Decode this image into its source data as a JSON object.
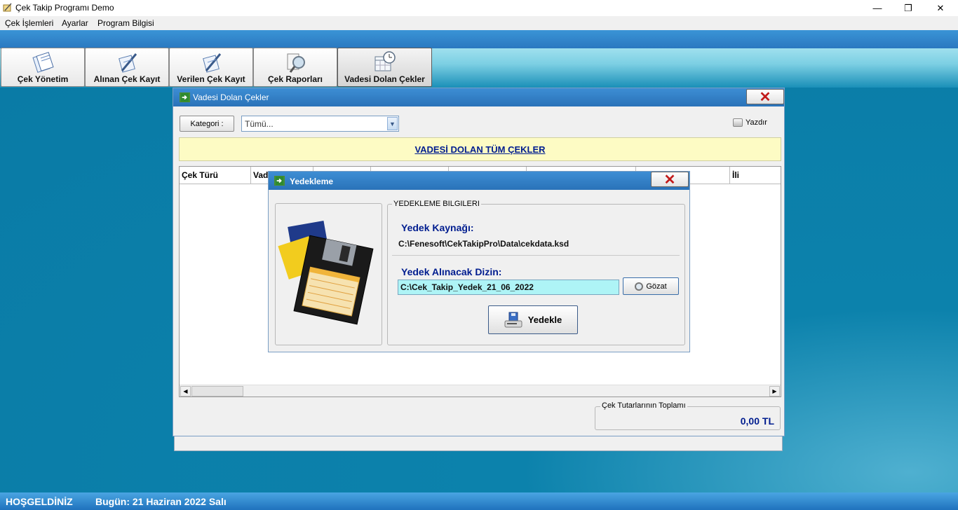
{
  "app": {
    "title": "Çek Takip Programı Demo",
    "window_controls": {
      "minimize": "—",
      "maximize": "❐",
      "close": "✕"
    }
  },
  "menu": {
    "items": [
      "Çek İşlemleri",
      "Ayarlar",
      "Program Bilgisi"
    ]
  },
  "toolbar": {
    "buttons": [
      {
        "label": "Çek Yönetim",
        "icon": "documents-icon"
      },
      {
        "label": "Alınan Çek Kayıt",
        "icon": "pen-note-icon"
      },
      {
        "label": "Verilen Çek Kayıt",
        "icon": "pen-note-icon"
      },
      {
        "label": "Çek Raporları",
        "icon": "search-report-icon"
      },
      {
        "label": "Vadesi Dolan Çekler",
        "icon": "calendar-clock-icon",
        "active": true
      }
    ]
  },
  "vadesi_window": {
    "title": "Vadesi Dolan Çekler",
    "kategori_label": "Kategori :",
    "kategori_value": "Tümü...",
    "print_label": "Yazdır",
    "banner": "VADESİ DOLAN TÜM ÇEKLER",
    "columns": [
      "Çek Türü",
      "Vad",
      "",
      "",
      "",
      "",
      "",
      "İli"
    ],
    "total_legend": "Çek Tutarlarının Toplamı",
    "total_value": "0,00 TL"
  },
  "yedek_dialog": {
    "title": "Yedekleme",
    "group_legend": "YEDEKLEME BILGILERI",
    "source_label": "Yedek Kaynağı:",
    "source_path": "C:\\Fenesoft\\CekTakipPro\\Data\\cekdata.ksd",
    "target_label": "Yedek Alınacak Dizin:",
    "target_path": "C:\\Cek_Takip_Yedek_21_06_2022",
    "browse_label": "Gözat",
    "backup_label": "Yedekle"
  },
  "status": {
    "welcome": "HOŞGELDİNİZ",
    "today": "Bugün: 21 Haziran 2022 Salı"
  },
  "colors": {
    "accent_blue": "#2a78c0",
    "banner_bg": "#fdfbc4",
    "banner_text": "#001d8f",
    "close_red": "#c21a1a"
  }
}
